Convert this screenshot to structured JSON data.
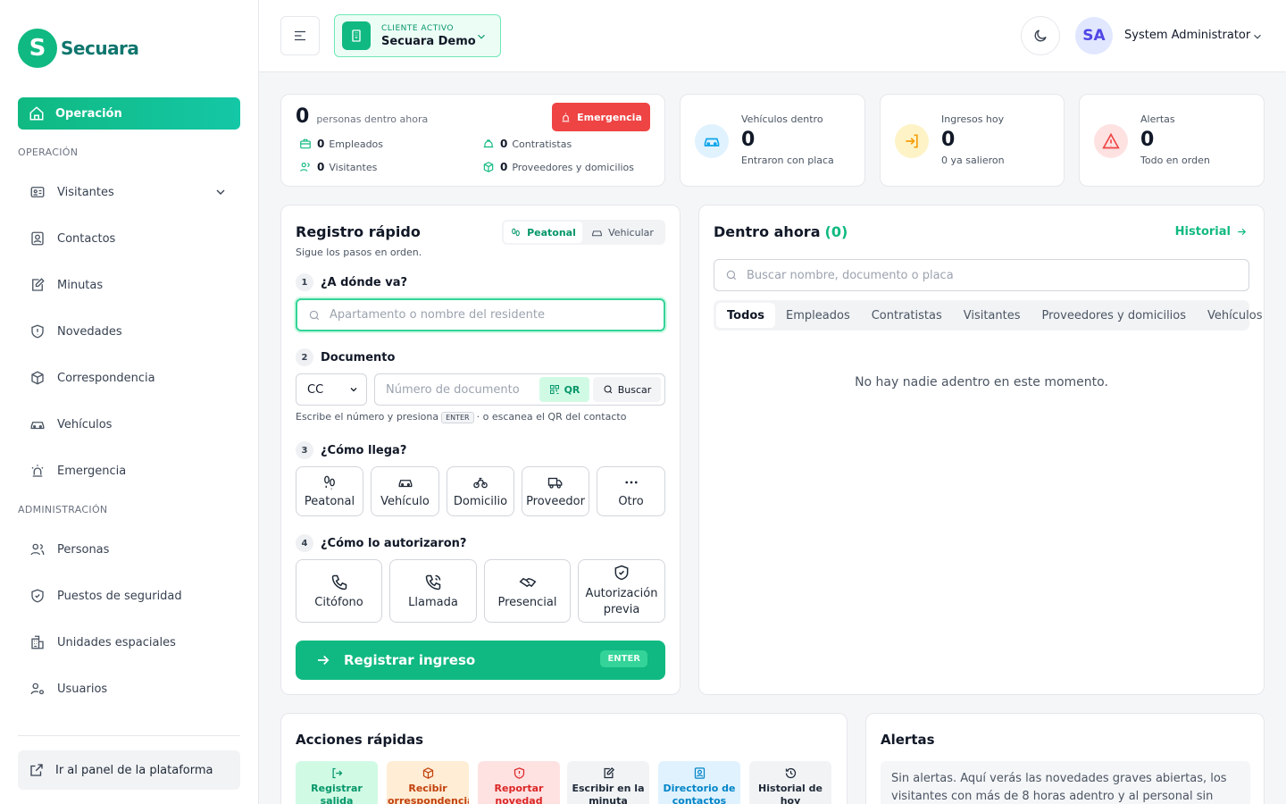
{
  "brand": {
    "letter": "S",
    "name": "Secuara"
  },
  "sidebar": {
    "active_label": "Operación",
    "section_operacion": "OPERACIÓN",
    "section_admin": "ADMINISTRACIÓN",
    "items": [
      {
        "label": "Visitantes"
      },
      {
        "label": "Contactos"
      },
      {
        "label": "Minutas"
      },
      {
        "label": "Novedades"
      },
      {
        "label": "Correspondencia"
      },
      {
        "label": "Vehículos"
      },
      {
        "label": "Emergencia"
      }
    ],
    "admin_items": [
      {
        "label": "Personas"
      },
      {
        "label": "Puestos de seguridad"
      },
      {
        "label": "Unidades espaciales"
      },
      {
        "label": "Usuarios"
      }
    ],
    "platform_button": "Ir al panel de la plataforma"
  },
  "topbar": {
    "client_label": "CLIENTE ACTIVO",
    "client_name": "Secuara Demo",
    "user_initials": "SA",
    "user_name": "System Administrator"
  },
  "presence": {
    "total": "0",
    "total_label": "personas dentro ahora",
    "emergency_button": "Emergencia",
    "employees_count": "0",
    "employees_label": "Empleados",
    "contractors_count": "0",
    "contractors_label": "Contratistas",
    "visitors_count": "0",
    "visitors_label": "Visitantes",
    "suppliers_count": "0",
    "suppliers_label": "Proveedores y domicilios"
  },
  "metrics": [
    {
      "label": "Vehículos dentro",
      "value": "0",
      "sub": "Entraron con placa"
    },
    {
      "label": "Ingresos hoy",
      "value": "0",
      "sub": "0 ya salieron"
    },
    {
      "label": "Alertas",
      "value": "0",
      "sub": "Todo en orden"
    }
  ],
  "registro": {
    "title": "Registro rápido",
    "subtitle": "Sigue los pasos en orden.",
    "toggle_on": "Peatonal",
    "toggle_off": "Vehicular",
    "step1_num": "1",
    "step1": "¿A dónde va?",
    "step1_placeholder": "Apartamento o nombre del residente",
    "step2_num": "2",
    "step2": "Documento",
    "doc_type": "CC",
    "doc_placeholder": "Número de documento",
    "qr_label": "QR",
    "search_label": "Buscar",
    "hint_before": "Escribe el número y presiona",
    "hint_key": "ENTER",
    "hint_after": "· o escanea el QR del contacto",
    "step3_num": "3",
    "step3": "¿Cómo llega?",
    "arrival": [
      "Peatonal",
      "Vehículo",
      "Domicilio",
      "Proveedor",
      "Otro"
    ],
    "step4_num": "4",
    "step4": "¿Cómo lo autorizaron?",
    "auth": [
      "Citófono",
      "Llamada",
      "Presencial",
      "Autorización previa"
    ],
    "submit_label": "Registrar ingreso",
    "submit_key": "ENTER"
  },
  "dentro": {
    "title": "Dentro ahora",
    "count": "(0)",
    "history_link": "Historial",
    "search_placeholder": "Buscar nombre, documento o placa",
    "tabs": [
      "Todos",
      "Empleados",
      "Contratistas",
      "Visitantes",
      "Proveedores y domicilios",
      "Vehículos"
    ],
    "empty_message": "No hay nadie adentro en este momento."
  },
  "acciones": {
    "title": "Acciones rápidas",
    "items": [
      {
        "label": "Registrar salida",
        "color": "#059669",
        "bg": "#d1fae5"
      },
      {
        "label": "Recibir correspondencia",
        "color": "#c2410c",
        "bg": "#ffedd5"
      },
      {
        "label": "Reportar novedad",
        "color": "#dc2626",
        "bg": "#fee2e2"
      },
      {
        "label": "Escribir en la minuta",
        "color": "#1f2937",
        "bg": "#f1f3f5"
      },
      {
        "label": "Directorio de contactos",
        "color": "#0284c7",
        "bg": "#e0f2fe"
      },
      {
        "label": "Historial de hoy",
        "color": "#1f2937",
        "bg": "#f1f3f5"
      }
    ]
  },
  "alertas": {
    "title": "Alertas",
    "message": "Sin alertas. Aquí verás las novedades graves abiertas, los visitantes con más de 8 horas adentro y al personal sin salida"
  },
  "colors": {
    "accent": "#10b981",
    "danger": "#ef4444",
    "warning": "#f59e0b",
    "info": "#0ea5e9"
  }
}
